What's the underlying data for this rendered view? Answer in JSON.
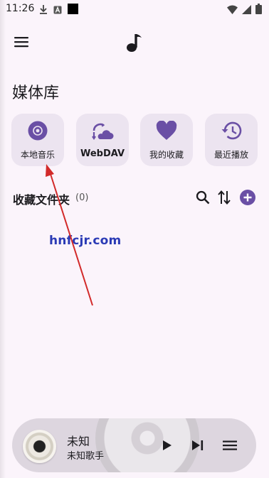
{
  "status_bar": {
    "time": "11:26",
    "icons_left": [
      "download-icon",
      "font-a-icon",
      "black-square-icon"
    ],
    "icons_right": [
      "wifi-icon",
      "signal-icon",
      "battery-icon"
    ]
  },
  "header": {
    "menu_icon": "hamburger-icon",
    "app_icon": "music-note-icon"
  },
  "page_title": "媒体库",
  "tiles": [
    {
      "label": "本地音乐",
      "icon": "disc-icon"
    },
    {
      "label": "WebDAV",
      "icon": "cloud-sync-icon"
    },
    {
      "label": "我的收藏",
      "icon": "heart-icon"
    },
    {
      "label": "最近播放",
      "icon": "history-icon"
    }
  ],
  "favorites": {
    "title": "收藏文件夹",
    "count": "(0)",
    "actions": [
      "search-icon",
      "sort-icon",
      "add-circle-icon"
    ]
  },
  "watermark": "hnfcjr.com",
  "player": {
    "title": "未知",
    "artist": "未知歌手",
    "controls": [
      "play-icon",
      "skip-next-icon",
      "playlist-icon"
    ]
  },
  "colors": {
    "accent": "#6a4fa5",
    "background": "#fbf4fb",
    "tile_bg": "#ece4f0",
    "arrow": "#d22a2a"
  }
}
